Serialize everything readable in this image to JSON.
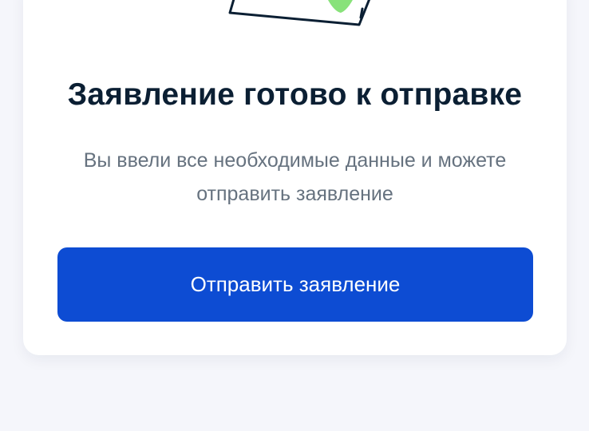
{
  "card": {
    "title": "Заявление готово к отправке",
    "subtitle": "Вы ввели все необходимые данные и можете отправить заявление",
    "submit_label": "Отправить заявление"
  },
  "illustration": {
    "name": "document-check-illustration",
    "check_color": "#88e27a",
    "outline_color": "#0b1f33"
  },
  "colors": {
    "background": "#f5f6fb",
    "card": "#ffffff",
    "accent": "#0d4cd3",
    "title": "#0b1f33",
    "subtitle": "#66727f"
  }
}
